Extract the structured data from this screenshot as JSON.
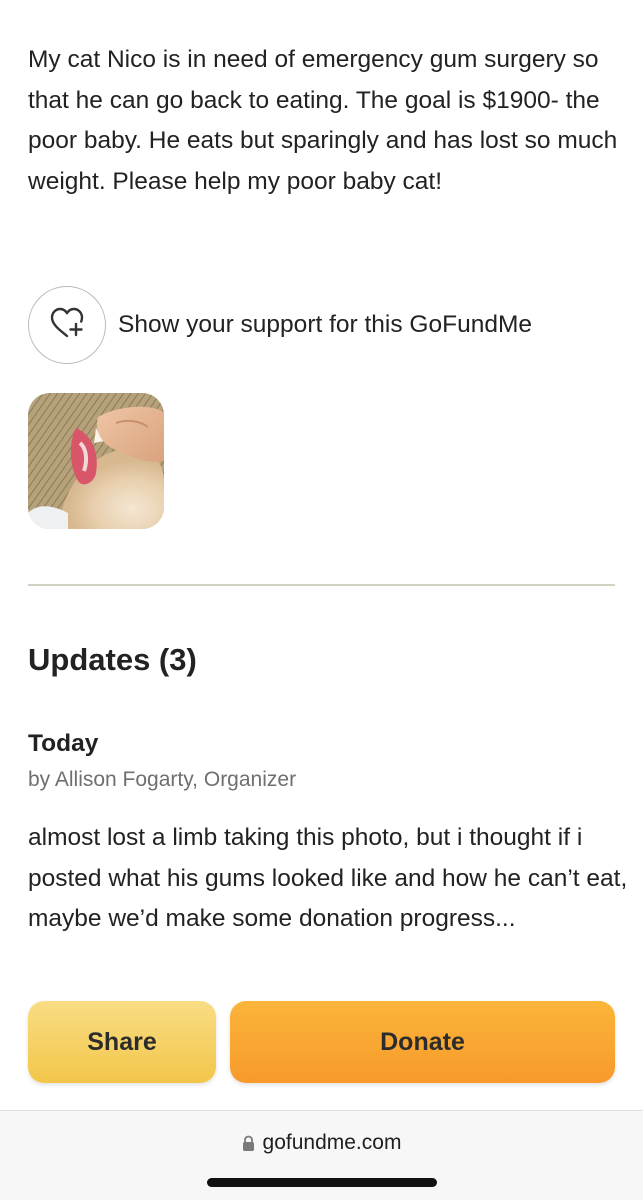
{
  "story": {
    "text": "My cat Nico is in need of emergency gum surgery so that he can go back to eating. The goal is $1900- the poor baby. He eats but sparingly and has lost so much weight. Please help my poor baby cat!"
  },
  "support": {
    "label": "Show your support for this GoFundMe",
    "icon": "heart-plus-icon"
  },
  "updates": {
    "title": "Updates (3)",
    "items": [
      {
        "date": "Today",
        "byline": "by Allison Fogarty, Organizer",
        "body": "almost lost a limb taking this photo, but i thought if i posted what his gums looked like and how he can’t eat, maybe we’d make some donation progress..."
      }
    ]
  },
  "actions": {
    "share_label": "Share",
    "donate_label": "Donate",
    "share_color": "#f5cf5e",
    "donate_color": "#f9a832"
  },
  "browser": {
    "url": "gofundme.com",
    "lock_icon": "lock-icon"
  }
}
